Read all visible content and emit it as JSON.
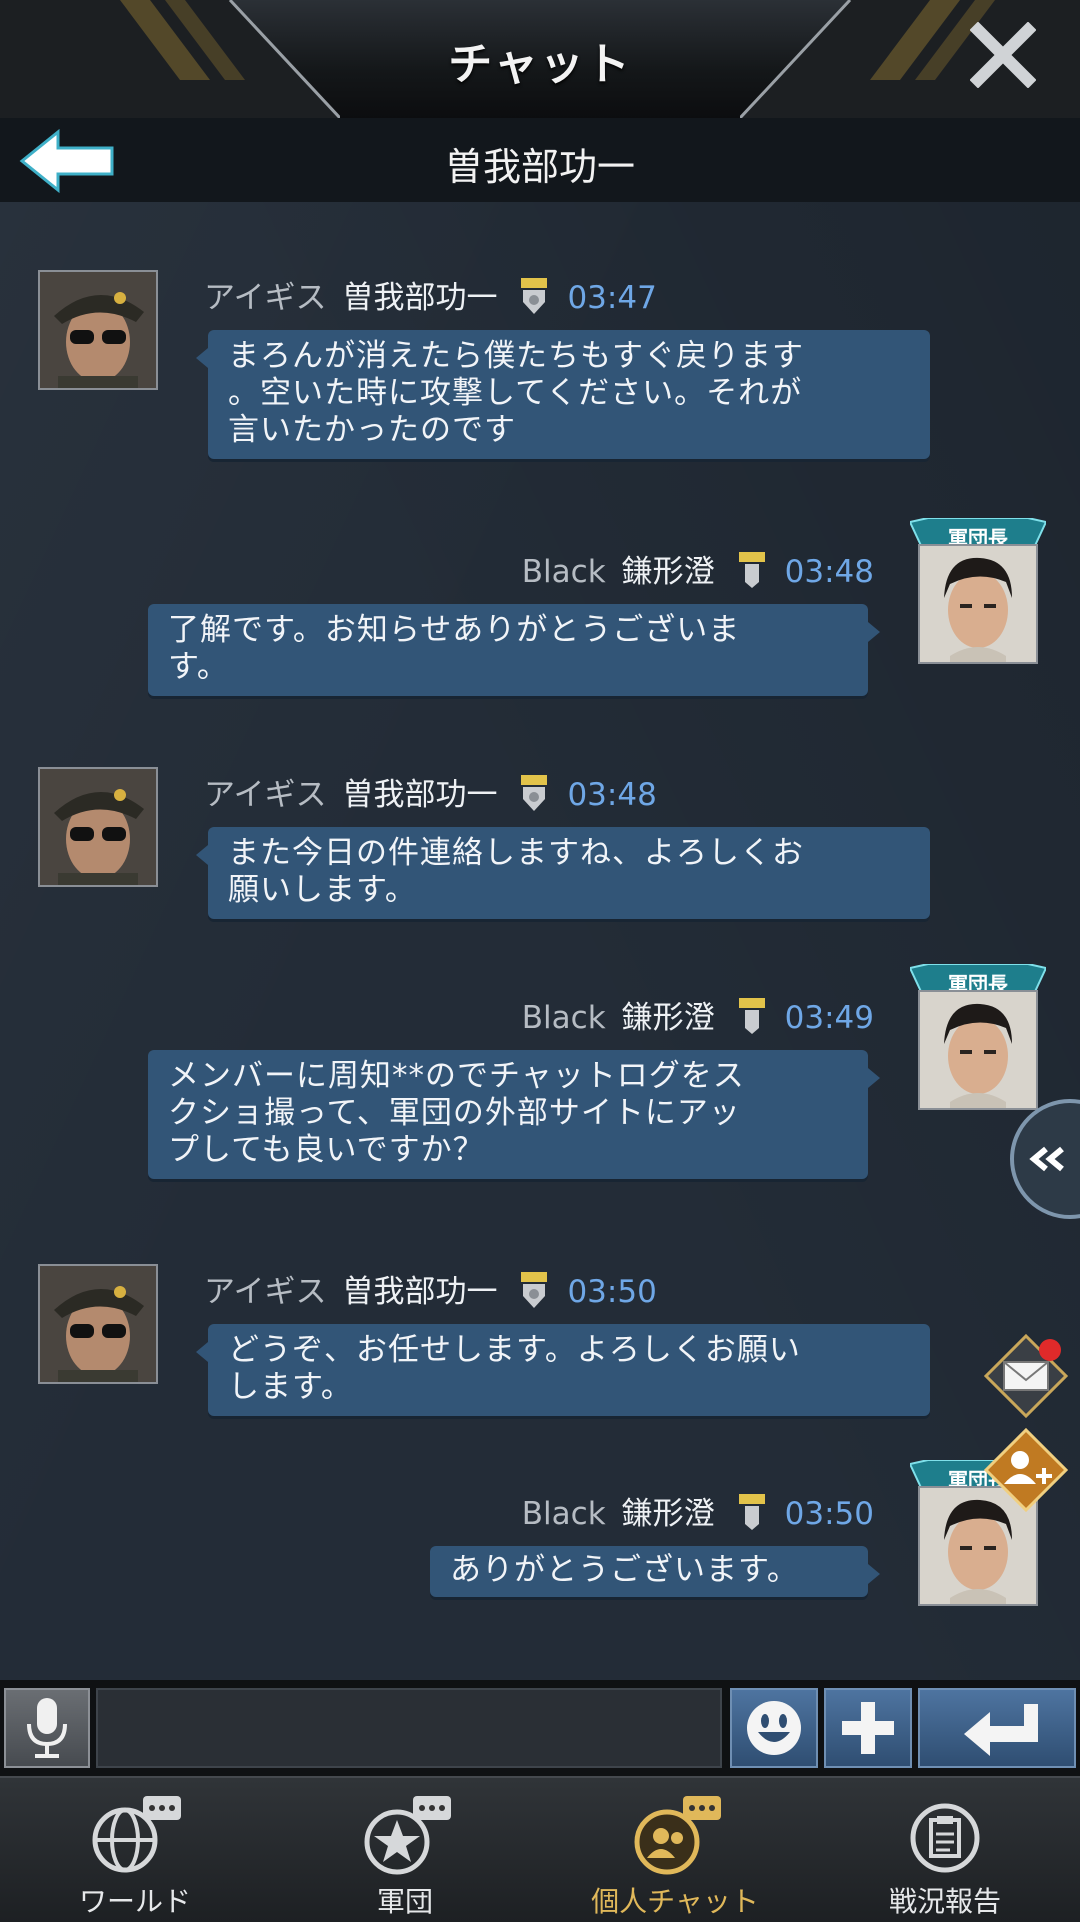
{
  "header": {
    "title": "チャット",
    "subtitle": "曽我部功一"
  },
  "messages": [
    {
      "side": "left",
      "alliance": "アイギス",
      "name": "曽我部功一",
      "time": "03:47",
      "lines": [
        "まろんが消えたら僕たちもすぐ戻ります",
        "。空いた時に攻撃してください。それが",
        "言いたかったのです"
      ]
    },
    {
      "side": "right",
      "rank": "軍団長",
      "alliance": "Black",
      "name": "鎌形澄",
      "time": "03:48",
      "lines": [
        "了解です。お知らせありがとうございま",
        "す。"
      ]
    },
    {
      "side": "left",
      "alliance": "アイギス",
      "name": "曽我部功一",
      "time": "03:48",
      "lines": [
        "また今日の件連絡しますね、よろしくお",
        "願いします。"
      ]
    },
    {
      "side": "right",
      "rank": "軍団長",
      "alliance": "Black",
      "name": "鎌形澄",
      "time": "03:49",
      "lines": [
        "メンバーに周知**のでチャットログをス",
        "クショ撮って、軍団の外部サイトにアッ",
        "プしても良いですか？"
      ]
    },
    {
      "side": "left",
      "alliance": "アイギス",
      "name": "曽我部功一",
      "time": "03:50",
      "lines": [
        "どうぞ、お任せします。よろしくお願い",
        "します。"
      ]
    },
    {
      "side": "right",
      "rank": "軍団長",
      "alliance": "Black",
      "name": "鎌形澄",
      "time": "03:50",
      "lines": [
        "ありがとうございます。"
      ]
    }
  ],
  "input": {
    "value": "",
    "placeholder": ""
  },
  "nav": [
    {
      "label": "ワールド",
      "icon": "globe-chat-icon"
    },
    {
      "label": "軍団",
      "icon": "star-chat-icon"
    },
    {
      "label": "個人チャット",
      "icon": "private-chat-icon",
      "active": true
    },
    {
      "label": "戦況報告",
      "icon": "report-icon"
    }
  ],
  "colors": {
    "bubble": "#325577",
    "time": "#6fa7e6",
    "active_nav": "#e0b85a",
    "rank_tag": "#2a8a9a"
  }
}
